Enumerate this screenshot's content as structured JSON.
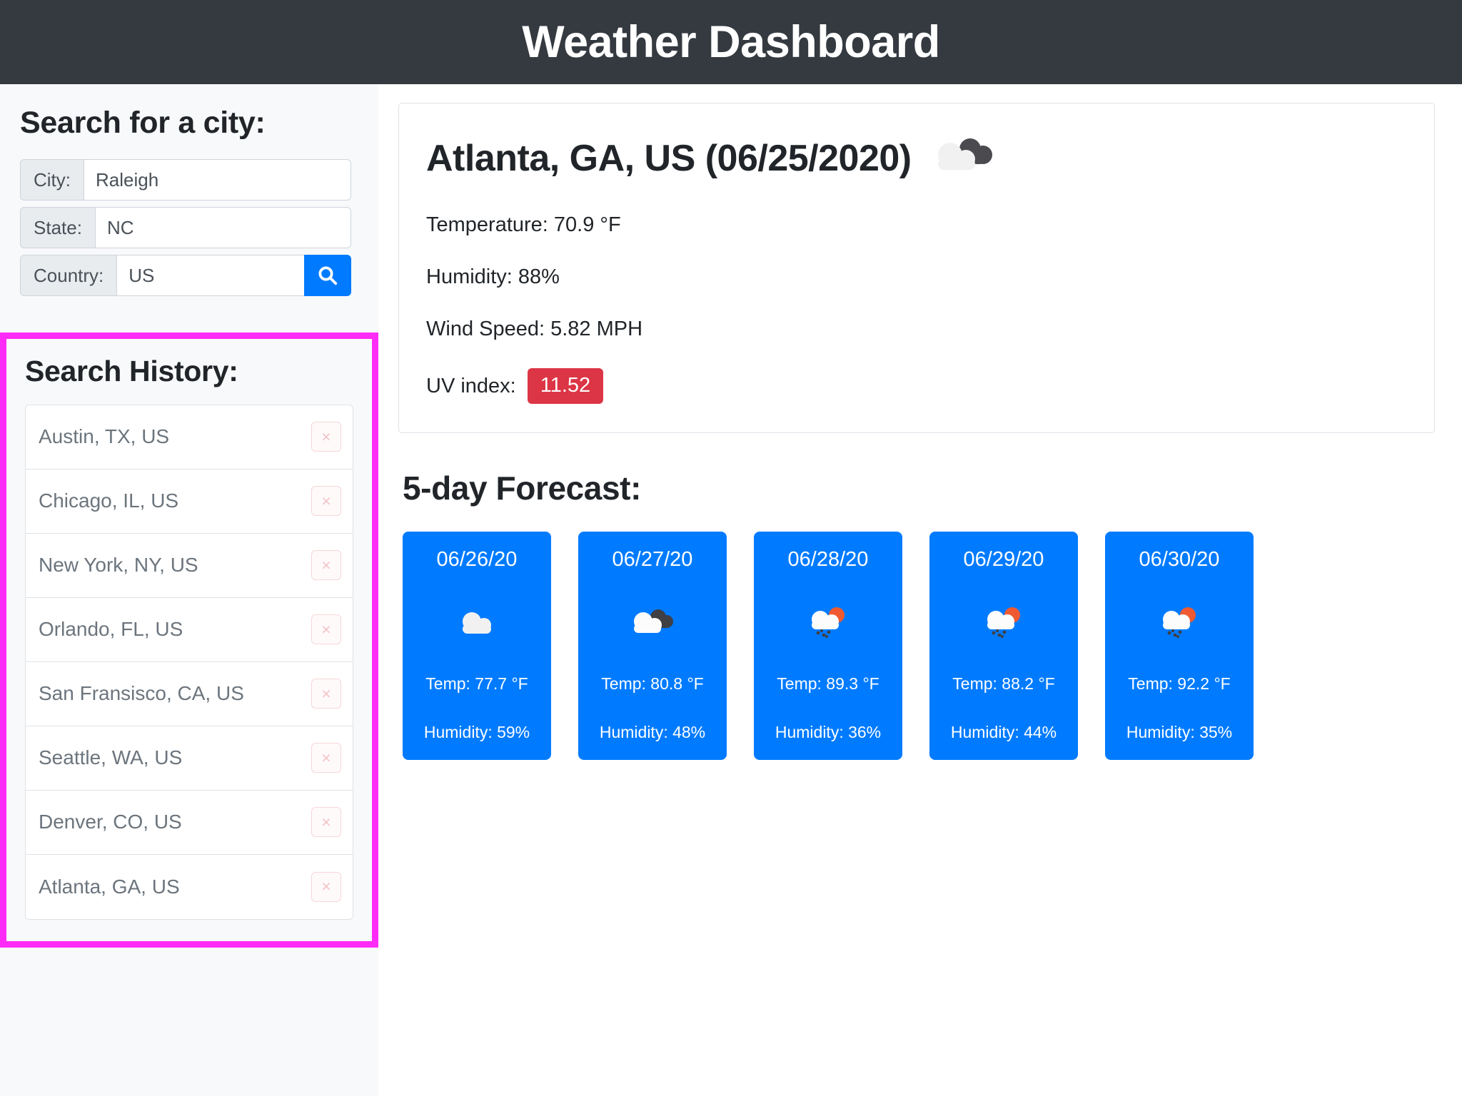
{
  "header": {
    "title": "Weather Dashboard"
  },
  "sidebar": {
    "search": {
      "heading": "Search for a city:",
      "fields": [
        {
          "label": "City:",
          "value": "Raleigh",
          "name": "city"
        },
        {
          "label": "State:",
          "value": "NC",
          "name": "state"
        },
        {
          "label": "Country:",
          "value": "US",
          "name": "country"
        }
      ],
      "search_button_icon": "search-icon"
    },
    "history": {
      "heading": "Search History:",
      "delete_icon": "close-icon",
      "items": [
        {
          "label": "Austin, TX, US"
        },
        {
          "label": "Chicago, IL, US"
        },
        {
          "label": "New York, NY, US"
        },
        {
          "label": "Orlando, FL, US"
        },
        {
          "label": "San Fransisco, CA, US"
        },
        {
          "label": "Seattle, WA, US"
        },
        {
          "label": "Denver, CO, US"
        },
        {
          "label": "Atlanta, GA, US"
        }
      ]
    }
  },
  "current": {
    "title": "Atlanta, GA, US (06/25/2020)",
    "icon": "broken-clouds-icon",
    "temperature": "Temperature: 70.9 °F",
    "humidity": "Humidity: 88%",
    "wind": "Wind Speed: 5.82 MPH",
    "uv_label": "UV index:",
    "uv_value": "11.52",
    "uv_color": "#dc3545"
  },
  "forecast": {
    "heading": "5-day Forecast:",
    "card_color": "#007bff",
    "days": [
      {
        "date": "06/26/20",
        "icon": "cloud-icon",
        "temp": "Temp: 77.7 °F",
        "humidity": "Humidity: 59%"
      },
      {
        "date": "06/27/20",
        "icon": "broken-clouds-icon",
        "temp": "Temp: 80.8 °F",
        "humidity": "Humidity: 48%"
      },
      {
        "date": "06/28/20",
        "icon": "sun-rain-cloud-icon",
        "temp": "Temp: 89.3 °F",
        "humidity": "Humidity: 36%"
      },
      {
        "date": "06/29/20",
        "icon": "sun-rain-cloud-icon",
        "temp": "Temp: 88.2 °F",
        "humidity": "Humidity: 44%"
      },
      {
        "date": "06/30/20",
        "icon": "sun-rain-cloud-icon",
        "temp": "Temp: 92.2 °F",
        "humidity": "Humidity: 35%"
      }
    ]
  }
}
